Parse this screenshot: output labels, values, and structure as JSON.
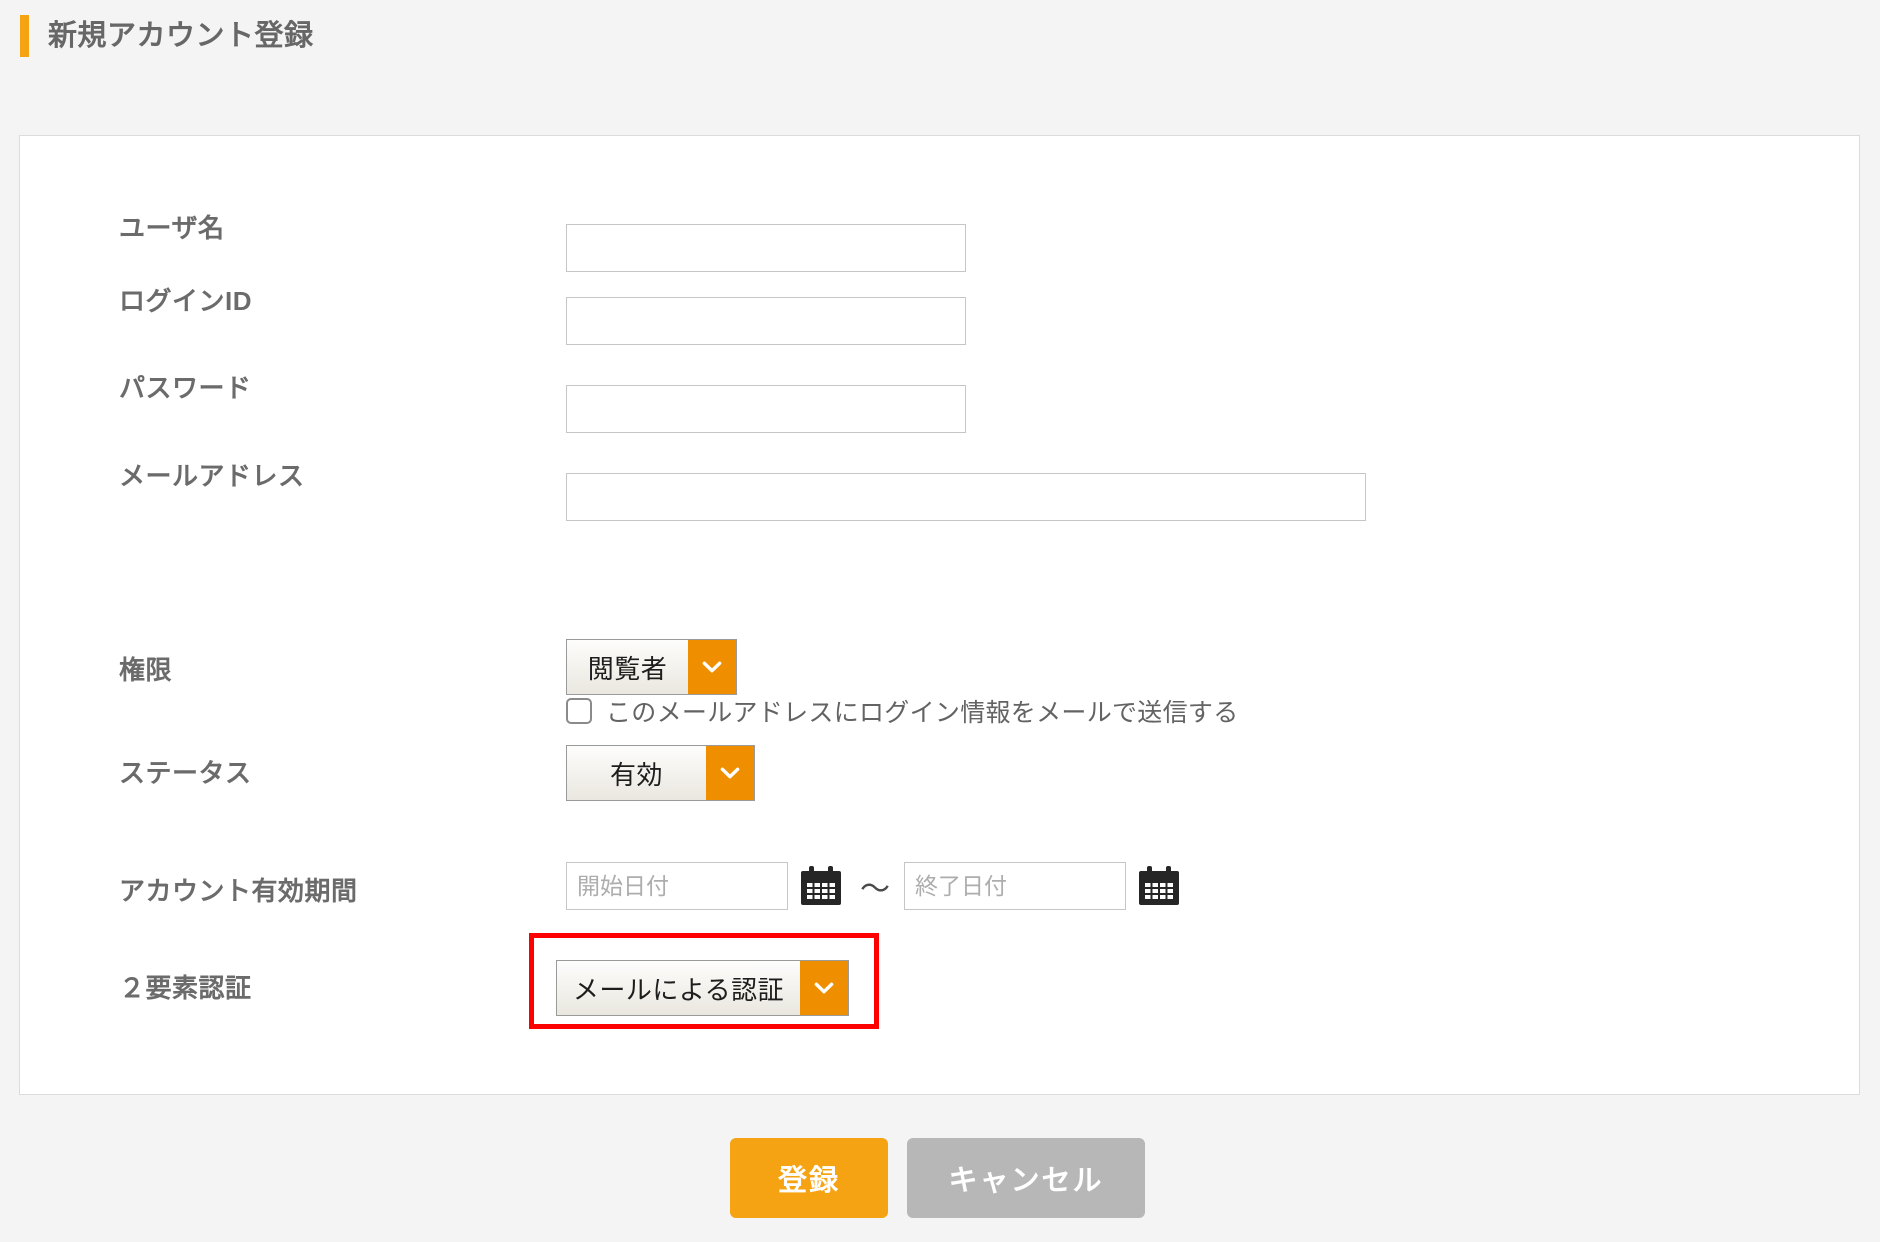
{
  "page": {
    "title": "新規アカウント登録",
    "accent_color": "#f5a312",
    "background_color": "#f4f4f4",
    "card_background": "#ffffff"
  },
  "form": {
    "fields": {
      "username": {
        "label": "ユーザ名",
        "value": "",
        "placeholder": ""
      },
      "login_id": {
        "label": "ログインID",
        "value": "",
        "placeholder": ""
      },
      "password": {
        "label": "パスワード",
        "value": "",
        "placeholder": ""
      },
      "email": {
        "label": "メールアドレス",
        "value": "",
        "placeholder": ""
      },
      "send_login_info": {
        "checkbox_label": "このメールアドレスにログイン情報をメールで送信する",
        "checked": false
      },
      "role": {
        "label": "権限",
        "selected": "閲覧者"
      },
      "status": {
        "label": "ステータス",
        "selected": "有効"
      },
      "validity_period": {
        "label": "アカウント有効期間",
        "start_placeholder": "開始日付",
        "start_value": "",
        "end_placeholder": "終了日付",
        "end_value": "",
        "separator": "〜",
        "start_icon": "calendar-icon",
        "end_icon": "calendar-icon"
      },
      "two_factor_auth": {
        "label": "２要素認証",
        "selected": "メールによる認証",
        "highlight_color": "#ff0000",
        "highlighted": true
      }
    }
  },
  "footer": {
    "submit_label": "登録",
    "cancel_label": "キャンセル",
    "submit_color": "#f5a312",
    "cancel_color": "#b7b7b7"
  },
  "icons": {
    "chevron_down": "chevron-down-icon",
    "calendar": "calendar-icon",
    "checkbox": "checkbox-icon"
  }
}
